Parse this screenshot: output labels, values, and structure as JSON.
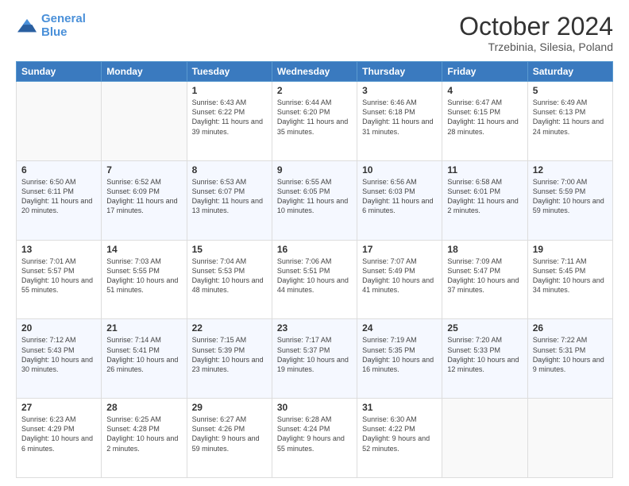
{
  "header": {
    "logo_line1": "General",
    "logo_line2": "Blue",
    "month_title": "October 2024",
    "location": "Trzebinia, Silesia, Poland"
  },
  "days_of_week": [
    "Sunday",
    "Monday",
    "Tuesday",
    "Wednesday",
    "Thursday",
    "Friday",
    "Saturday"
  ],
  "weeks": [
    [
      {
        "day": "",
        "info": ""
      },
      {
        "day": "",
        "info": ""
      },
      {
        "day": "1",
        "info": "Sunrise: 6:43 AM\nSunset: 6:22 PM\nDaylight: 11 hours and 39 minutes."
      },
      {
        "day": "2",
        "info": "Sunrise: 6:44 AM\nSunset: 6:20 PM\nDaylight: 11 hours and 35 minutes."
      },
      {
        "day": "3",
        "info": "Sunrise: 6:46 AM\nSunset: 6:18 PM\nDaylight: 11 hours and 31 minutes."
      },
      {
        "day": "4",
        "info": "Sunrise: 6:47 AM\nSunset: 6:15 PM\nDaylight: 11 hours and 28 minutes."
      },
      {
        "day": "5",
        "info": "Sunrise: 6:49 AM\nSunset: 6:13 PM\nDaylight: 11 hours and 24 minutes."
      }
    ],
    [
      {
        "day": "6",
        "info": "Sunrise: 6:50 AM\nSunset: 6:11 PM\nDaylight: 11 hours and 20 minutes."
      },
      {
        "day": "7",
        "info": "Sunrise: 6:52 AM\nSunset: 6:09 PM\nDaylight: 11 hours and 17 minutes."
      },
      {
        "day": "8",
        "info": "Sunrise: 6:53 AM\nSunset: 6:07 PM\nDaylight: 11 hours and 13 minutes."
      },
      {
        "day": "9",
        "info": "Sunrise: 6:55 AM\nSunset: 6:05 PM\nDaylight: 11 hours and 10 minutes."
      },
      {
        "day": "10",
        "info": "Sunrise: 6:56 AM\nSunset: 6:03 PM\nDaylight: 11 hours and 6 minutes."
      },
      {
        "day": "11",
        "info": "Sunrise: 6:58 AM\nSunset: 6:01 PM\nDaylight: 11 hours and 2 minutes."
      },
      {
        "day": "12",
        "info": "Sunrise: 7:00 AM\nSunset: 5:59 PM\nDaylight: 10 hours and 59 minutes."
      }
    ],
    [
      {
        "day": "13",
        "info": "Sunrise: 7:01 AM\nSunset: 5:57 PM\nDaylight: 10 hours and 55 minutes."
      },
      {
        "day": "14",
        "info": "Sunrise: 7:03 AM\nSunset: 5:55 PM\nDaylight: 10 hours and 51 minutes."
      },
      {
        "day": "15",
        "info": "Sunrise: 7:04 AM\nSunset: 5:53 PM\nDaylight: 10 hours and 48 minutes."
      },
      {
        "day": "16",
        "info": "Sunrise: 7:06 AM\nSunset: 5:51 PM\nDaylight: 10 hours and 44 minutes."
      },
      {
        "day": "17",
        "info": "Sunrise: 7:07 AM\nSunset: 5:49 PM\nDaylight: 10 hours and 41 minutes."
      },
      {
        "day": "18",
        "info": "Sunrise: 7:09 AM\nSunset: 5:47 PM\nDaylight: 10 hours and 37 minutes."
      },
      {
        "day": "19",
        "info": "Sunrise: 7:11 AM\nSunset: 5:45 PM\nDaylight: 10 hours and 34 minutes."
      }
    ],
    [
      {
        "day": "20",
        "info": "Sunrise: 7:12 AM\nSunset: 5:43 PM\nDaylight: 10 hours and 30 minutes."
      },
      {
        "day": "21",
        "info": "Sunrise: 7:14 AM\nSunset: 5:41 PM\nDaylight: 10 hours and 26 minutes."
      },
      {
        "day": "22",
        "info": "Sunrise: 7:15 AM\nSunset: 5:39 PM\nDaylight: 10 hours and 23 minutes."
      },
      {
        "day": "23",
        "info": "Sunrise: 7:17 AM\nSunset: 5:37 PM\nDaylight: 10 hours and 19 minutes."
      },
      {
        "day": "24",
        "info": "Sunrise: 7:19 AM\nSunset: 5:35 PM\nDaylight: 10 hours and 16 minutes."
      },
      {
        "day": "25",
        "info": "Sunrise: 7:20 AM\nSunset: 5:33 PM\nDaylight: 10 hours and 12 minutes."
      },
      {
        "day": "26",
        "info": "Sunrise: 7:22 AM\nSunset: 5:31 PM\nDaylight: 10 hours and 9 minutes."
      }
    ],
    [
      {
        "day": "27",
        "info": "Sunrise: 6:23 AM\nSunset: 4:29 PM\nDaylight: 10 hours and 6 minutes."
      },
      {
        "day": "28",
        "info": "Sunrise: 6:25 AM\nSunset: 4:28 PM\nDaylight: 10 hours and 2 minutes."
      },
      {
        "day": "29",
        "info": "Sunrise: 6:27 AM\nSunset: 4:26 PM\nDaylight: 9 hours and 59 minutes."
      },
      {
        "day": "30",
        "info": "Sunrise: 6:28 AM\nSunset: 4:24 PM\nDaylight: 9 hours and 55 minutes."
      },
      {
        "day": "31",
        "info": "Sunrise: 6:30 AM\nSunset: 4:22 PM\nDaylight: 9 hours and 52 minutes."
      },
      {
        "day": "",
        "info": ""
      },
      {
        "day": "",
        "info": ""
      }
    ]
  ]
}
